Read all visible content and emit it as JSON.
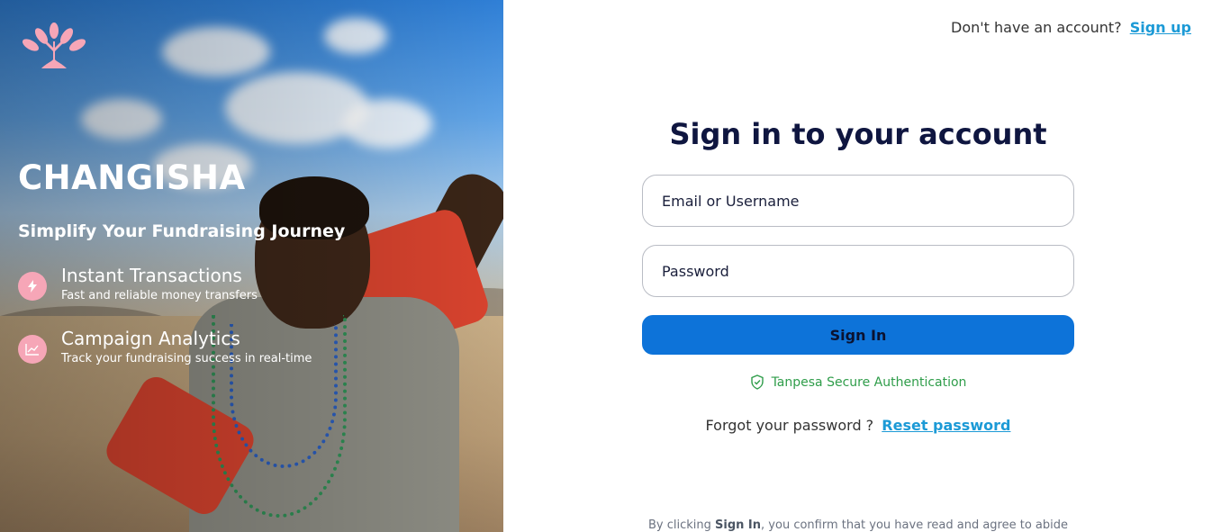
{
  "hero": {
    "brand": "CHANGISHA",
    "tagline": "Simplify Your Fundraising Journey",
    "features": [
      {
        "icon": "lightning-icon",
        "title": "Instant Transactions",
        "description": "Fast and reliable money transfers"
      },
      {
        "icon": "chart-line-icon",
        "title": "Campaign Analytics",
        "description": "Track your fundraising success in real-time"
      }
    ]
  },
  "topnav": {
    "prompt": "Don't have an account?",
    "signup_label": "Sign up"
  },
  "form": {
    "title": "Sign in to your account",
    "email_placeholder": "Email or Username",
    "password_placeholder": "Password",
    "submit_label": "Sign In",
    "secure_text": "Tanpesa Secure Authentication",
    "forgot_prompt": "Forgot your password ?",
    "reset_label": "Reset password",
    "legal_prefix": "By clicking",
    "legal_bold": "Sign In",
    "legal_suffix": ", you confirm that you have read and agree to abide"
  },
  "colors": {
    "primary": "#0d73d9",
    "link": "#1c9ad6",
    "heading": "#0f1640",
    "secure": "#2f9d4a",
    "feature_icon_bg": "#f6a6b7"
  }
}
